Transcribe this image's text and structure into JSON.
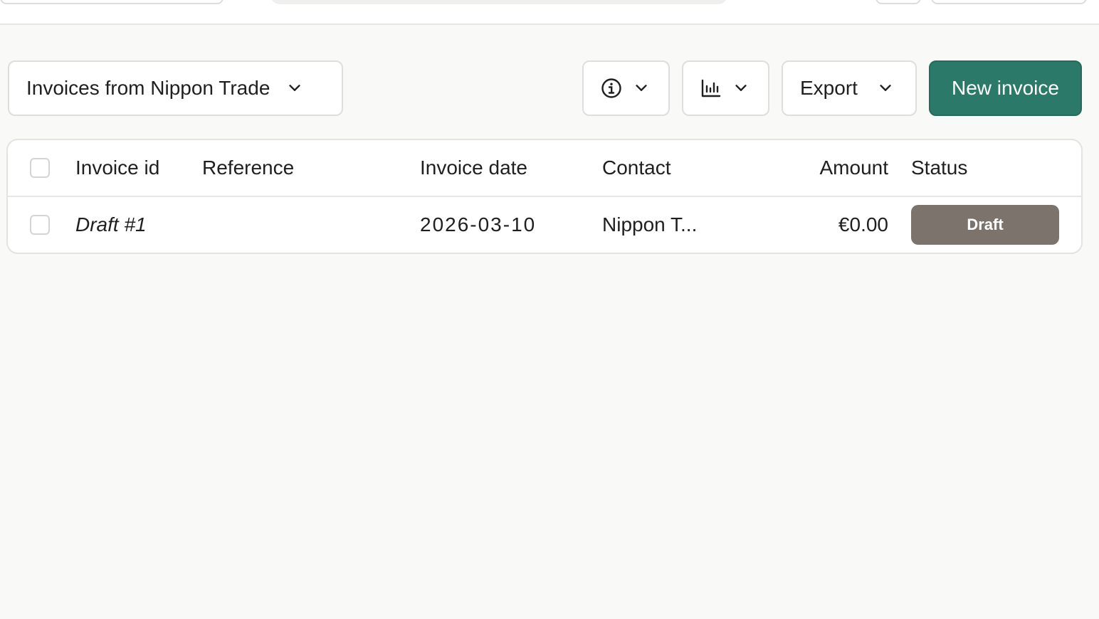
{
  "toolbar": {
    "filter_label": "Invoices from Nippon Trade",
    "export_label": "Export",
    "new_invoice_label": "New invoice",
    "accent_color": "#2b7a69"
  },
  "icons": {
    "info": "info-icon",
    "chart": "bar-chart-icon",
    "chevron": "chevron-down-icon"
  },
  "table": {
    "columns": [
      "Invoice id",
      "Reference",
      "Invoice date",
      "Contact",
      "Amount",
      "Status"
    ],
    "rows": [
      {
        "invoice_id": "Draft #1",
        "reference": "",
        "invoice_date": "2026-03-10",
        "contact": "Nippon T...",
        "amount": "€0.00",
        "status": "Draft",
        "status_color": "#7b736c"
      }
    ]
  }
}
